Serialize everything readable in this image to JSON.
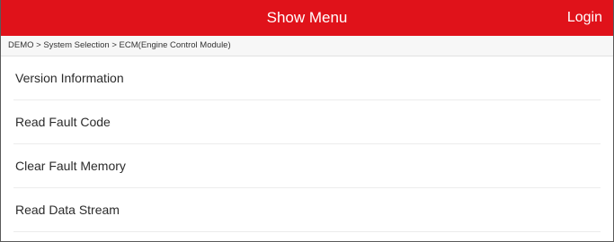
{
  "header": {
    "title": "Show Menu",
    "login_label": "Login",
    "bar_color": "#e0121a"
  },
  "breadcrumb": "DEMO > System Selection > ECM(Engine Control Module)",
  "menu": {
    "items": [
      {
        "label": "Version Information"
      },
      {
        "label": "Read Fault Code"
      },
      {
        "label": "Clear Fault Memory"
      },
      {
        "label": "Read Data Stream"
      }
    ]
  }
}
